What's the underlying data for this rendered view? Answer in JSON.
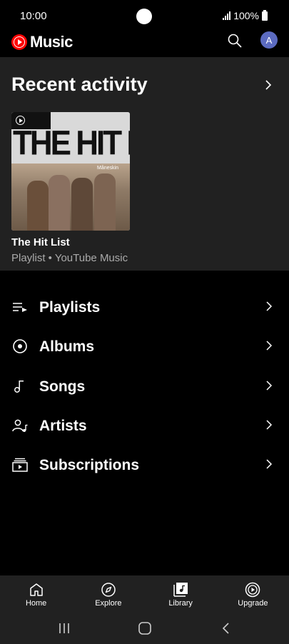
{
  "status_bar": {
    "time": "10:00",
    "battery": "100%"
  },
  "header": {
    "app_name": "Music",
    "avatar_letter": "A"
  },
  "recent": {
    "title": "Recent activity",
    "item": {
      "art_title": "THE HIT LIST",
      "art_artist": "Måneskin",
      "name": "The Hit List",
      "subtitle": "Playlist • YouTube Music"
    }
  },
  "library": {
    "items": [
      {
        "label": "Playlists",
        "icon": "playlist-icon"
      },
      {
        "label": "Albums",
        "icon": "album-icon"
      },
      {
        "label": "Songs",
        "icon": "music-note-icon"
      },
      {
        "label": "Artists",
        "icon": "artist-icon"
      },
      {
        "label": "Subscriptions",
        "icon": "subscriptions-icon"
      }
    ]
  },
  "bottom_nav": {
    "items": [
      {
        "label": "Home",
        "icon": "home-icon"
      },
      {
        "label": "Explore",
        "icon": "compass-icon"
      },
      {
        "label": "Library",
        "icon": "library-icon",
        "selected": true
      },
      {
        "label": "Upgrade",
        "icon": "upgrade-icon"
      }
    ]
  },
  "colors": {
    "accent": "#ff0000",
    "surface": "#212121",
    "background": "#000000",
    "avatar": "#5c6bc0"
  }
}
